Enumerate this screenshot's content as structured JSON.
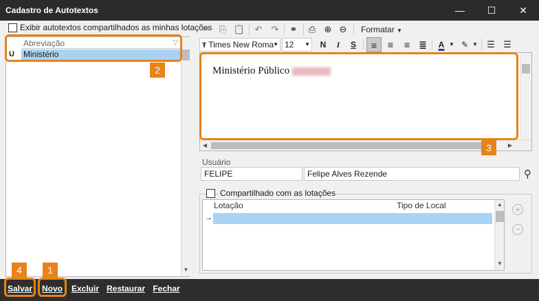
{
  "window": {
    "title": "Cadastro de Autotextos",
    "minimize_glyph": "—",
    "maximize_glyph": "☐",
    "close_glyph": "✕"
  },
  "left": {
    "show_shared_label": "Exibir autotextos compartilhados as minhas lotações",
    "list": {
      "header": "Abreviação",
      "header_icon": "filter-icon",
      "rows": [
        {
          "icon": "user-text-icon",
          "icon_glyph": "U",
          "label": "Ministério"
        }
      ]
    }
  },
  "toolbar": {
    "format_menu": "Formatar",
    "font_name": "Times New Roma",
    "font_size": "12",
    "bold": "N",
    "italic": "I",
    "strike": "S",
    "font_color_glyph": "A",
    "highlight_glyph": "✎",
    "icons": [
      "cut-icon",
      "copy-icon",
      "paste-icon",
      "undo-icon",
      "redo-icon",
      "find-icon",
      "print-icon",
      "zoom-in-icon",
      "zoom-out-icon",
      "align-left-icon",
      "align-center-icon",
      "align-right-icon",
      "justify-icon",
      "bullet-list-icon",
      "numbered-list-icon"
    ]
  },
  "editor": {
    "text": "Ministério Público"
  },
  "user": {
    "label": "Usuário",
    "login": "FELIPE",
    "name": "Felipe Alves Rezende"
  },
  "shared": {
    "label": "Compartilhado com as lotações",
    "columns": [
      "Lotação",
      "Tipo de Local"
    ],
    "row_marker": "→"
  },
  "bottom": {
    "save": "Salvar",
    "new": "Novo",
    "delete": "Excluir",
    "restore": "Restaurar",
    "close": "Fechar"
  },
  "callouts": [
    "1",
    "2",
    "3",
    "4"
  ],
  "colors": {
    "accent": "#e8821a",
    "selection": "#a8d3f2",
    "titlebar": "#2b2b2b",
    "bottombar": "#2e2e2e"
  }
}
